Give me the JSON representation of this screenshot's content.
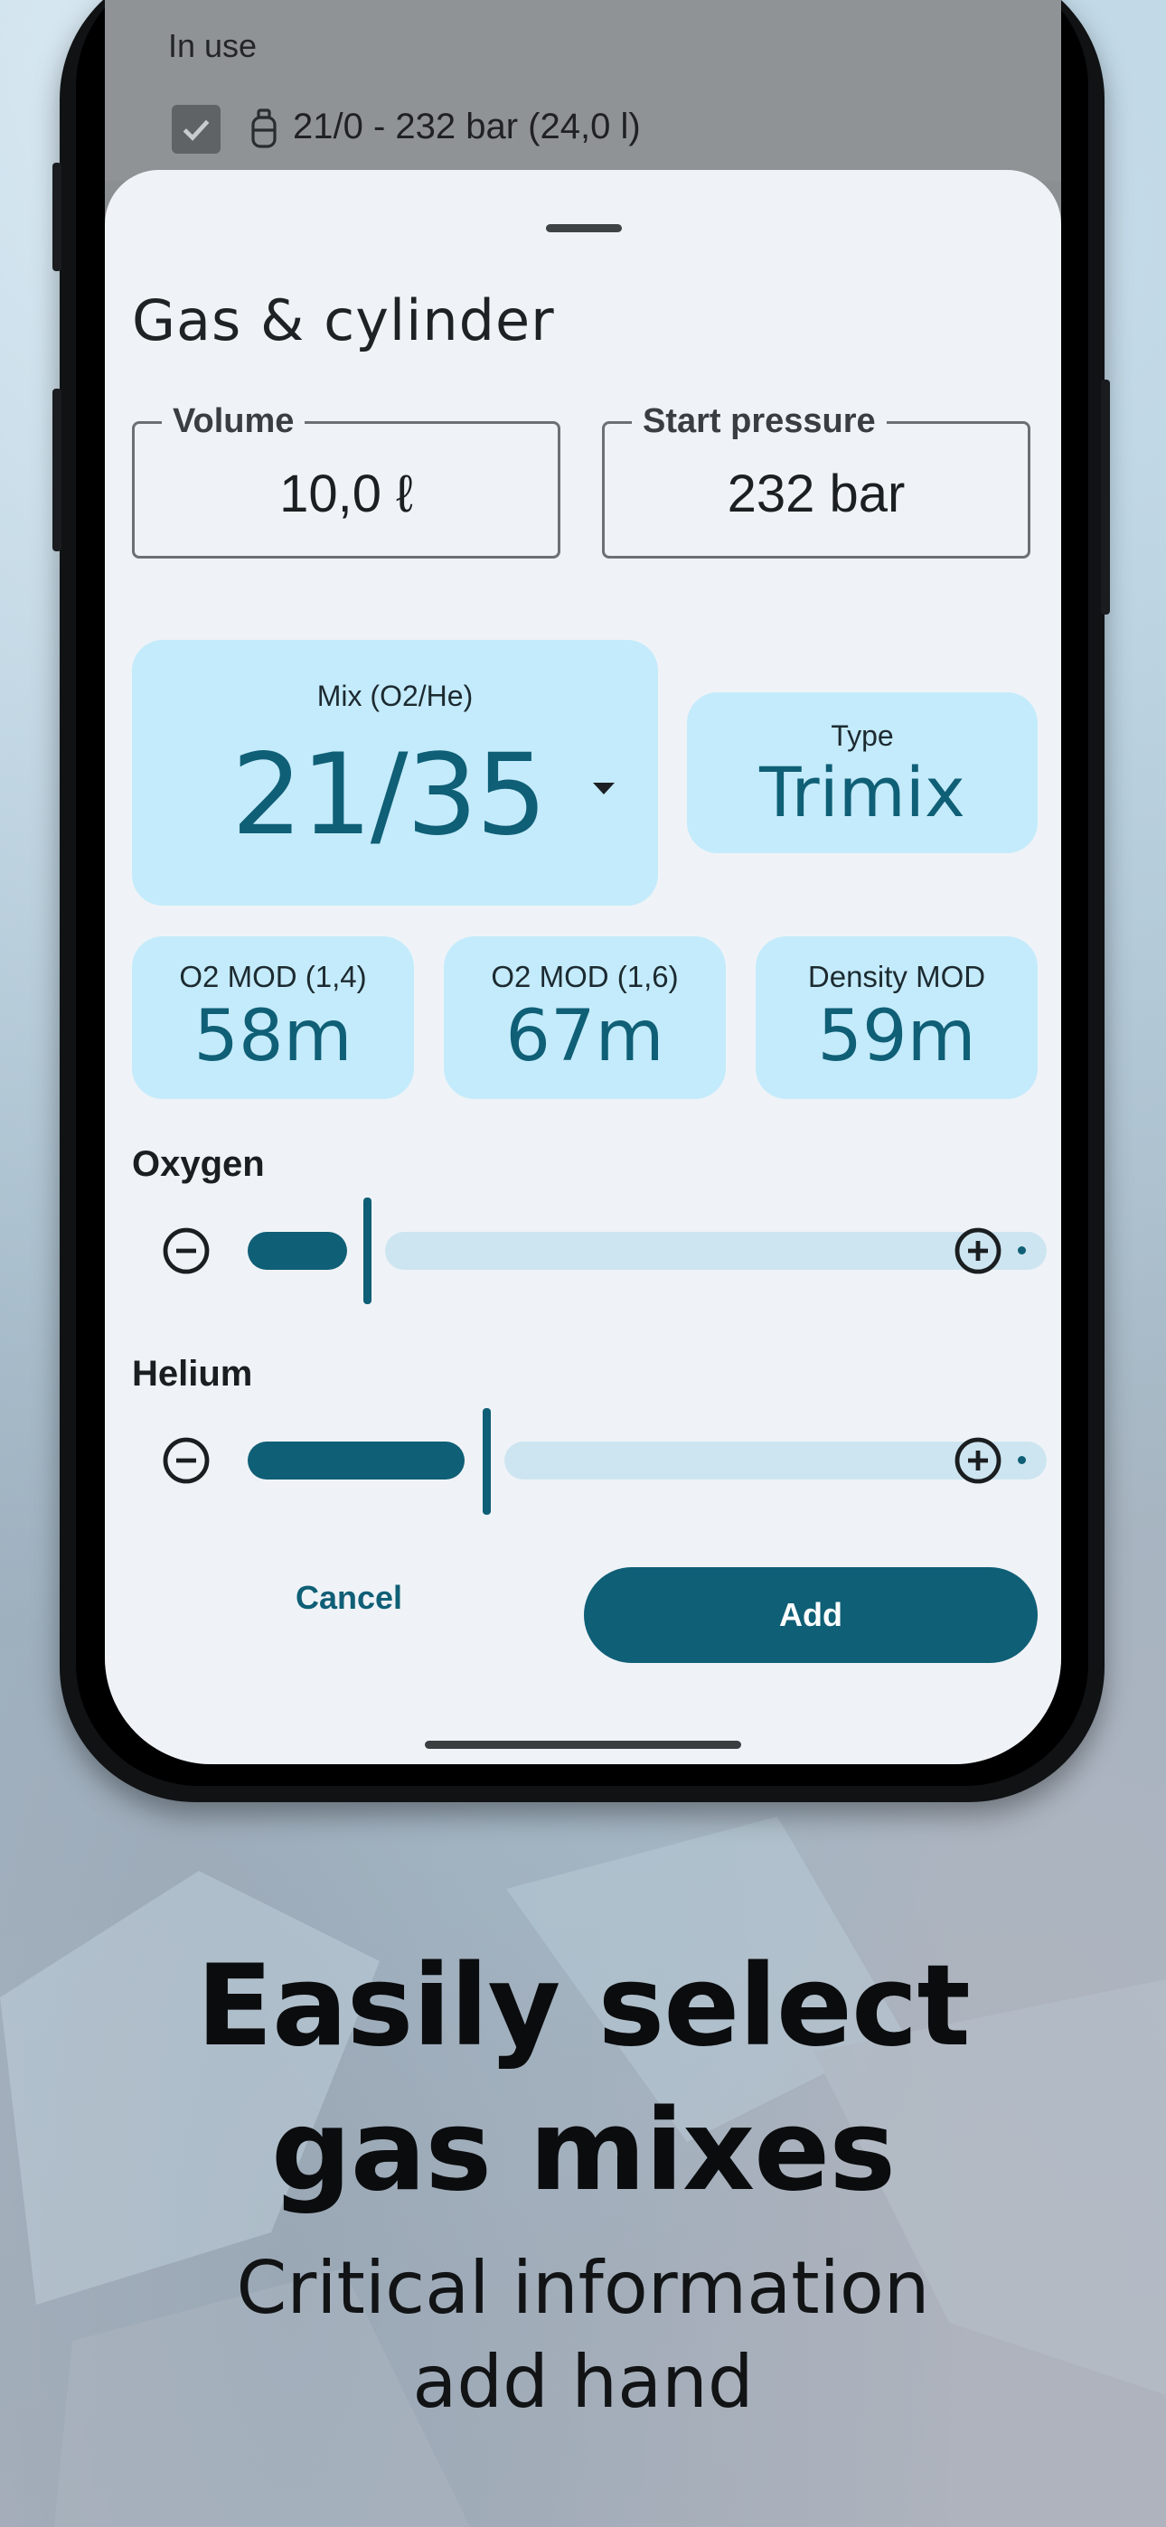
{
  "background_screen": {
    "section_label": "In use",
    "checkbox_checked": true,
    "tank_label": "21/0 - 232 bar (24,0 l)"
  },
  "sheet": {
    "title": "Gas & cylinder",
    "volume": {
      "label": "Volume",
      "value": "10,0 ℓ"
    },
    "start_pressure": {
      "label": "Start pressure",
      "value": "232 bar"
    },
    "mix": {
      "label": "Mix (O2/He)",
      "value": "21/35"
    },
    "type": {
      "label": "Type",
      "value": "Trimix"
    },
    "mods": [
      {
        "label": "O2 MOD (1,4)",
        "value": "58m"
      },
      {
        "label": "O2 MOD (1,6)",
        "value": "67m"
      },
      {
        "label": "Density MOD",
        "value": "59m"
      }
    ],
    "oxygen": {
      "label": "Oxygen",
      "value_percent": 21
    },
    "helium": {
      "label": "Helium",
      "value_percent": 35
    },
    "cancel_label": "Cancel",
    "add_label": "Add"
  },
  "marketing": {
    "headline_line1": "Easily select",
    "headline_line2": "gas mixes",
    "sub_line1": "Critical information",
    "sub_line2": "add hand"
  },
  "colors": {
    "accent": "#0f5f76",
    "card_bg": "#c4ebfb",
    "sheet_bg": "#eff3f7"
  },
  "icons": [
    "check-icon",
    "cylinder-icon",
    "minus-circle-icon",
    "plus-circle-icon",
    "dropdown-arrow-icon"
  ]
}
